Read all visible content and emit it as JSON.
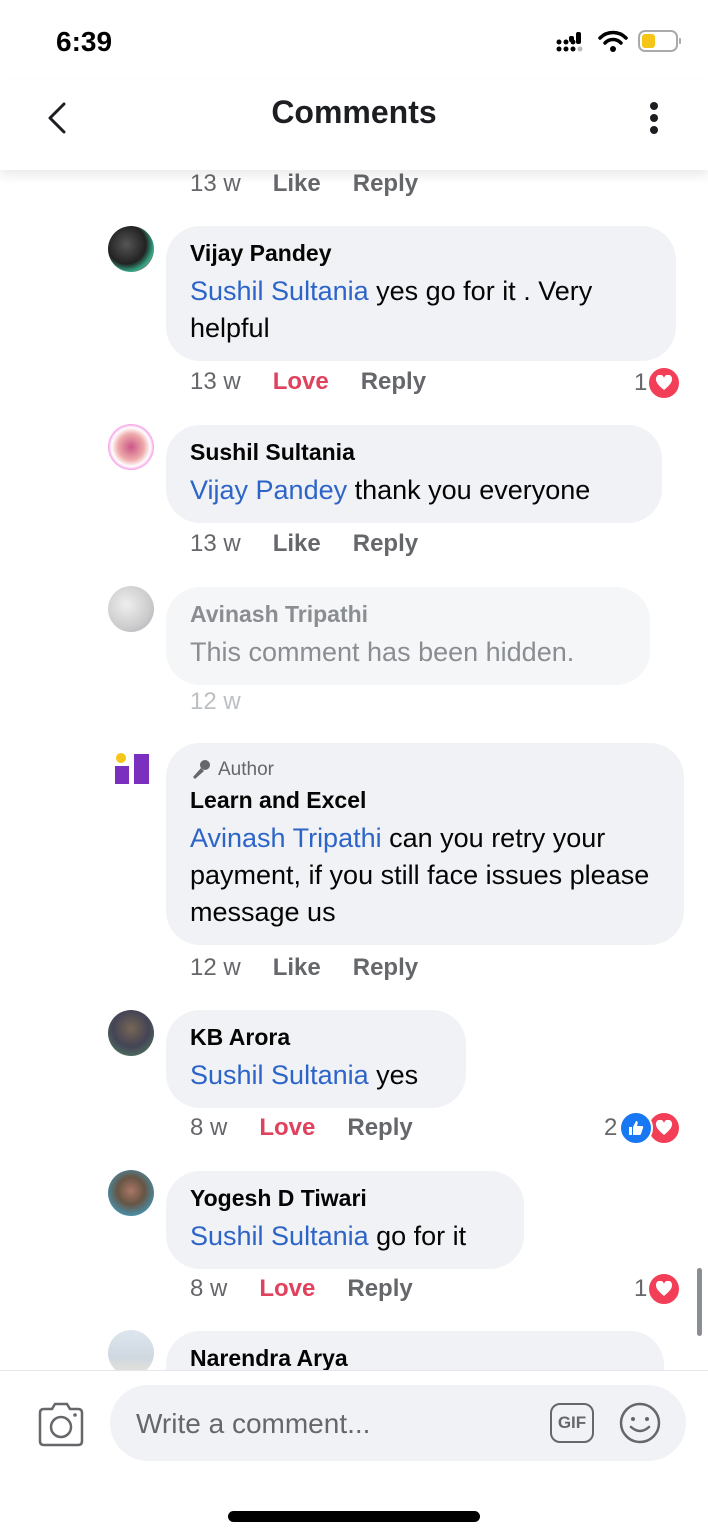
{
  "status_bar": {
    "time": "6:39"
  },
  "header": {
    "title": "Comments"
  },
  "top_meta": {
    "time": "13 w",
    "like": "Like",
    "reply": "Reply"
  },
  "comments": [
    {
      "author": "Vijay Pandey",
      "mention": "Sushil Sultania",
      "text": "  yes go for it . Very helpful",
      "time": "13 w",
      "reaction_action": "Love",
      "reply": "Reply",
      "reaction_count": "1",
      "reactions": [
        "love"
      ]
    },
    {
      "author": "Sushil Sultania",
      "mention": "Vijay Pandey",
      "text": " thank you everyone",
      "time": "13 w",
      "reaction_action": "Like",
      "reply": "Reply"
    },
    {
      "author": "Avinash Tripathi",
      "text": "This comment has been hidden.",
      "time": "12 w",
      "hidden": true
    },
    {
      "badge": "Author",
      "author": "Learn and Excel",
      "mention": "Avinash Tripathi",
      "text": " can you retry your payment, if you still face issues please message us",
      "time": "12 w",
      "reaction_action": "Like",
      "reply": "Reply"
    },
    {
      "author": "KB Arora",
      "mention": "Sushil Sultania",
      "text": " yes",
      "time": "8 w",
      "reaction_action": "Love",
      "reply": "Reply",
      "reaction_count": "2",
      "reactions": [
        "like",
        "love"
      ]
    },
    {
      "author": "Yogesh D Tiwari",
      "mention": "Sushil Sultania",
      "text": " go for it",
      "time": "8 w",
      "reaction_action": "Love",
      "reply": "Reply",
      "reaction_count": "1",
      "reactions": [
        "love"
      ]
    },
    {
      "author": "Narendra Arya"
    }
  ],
  "composer": {
    "placeholder": "Write a comment...",
    "gif_label": "GIF"
  },
  "colors": {
    "mention": "#2d64c8",
    "love": "#e0425d",
    "like": "#1877f2",
    "bubble": "#f0f2f5"
  }
}
